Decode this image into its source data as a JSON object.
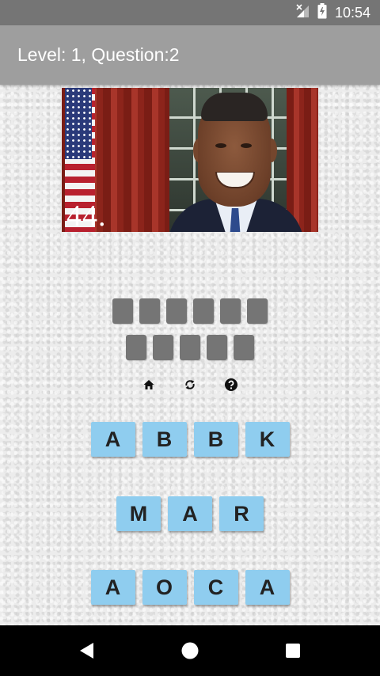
{
  "status_bar": {
    "time": "10:54",
    "icons": [
      "signal-off-icon",
      "battery-charging-icon"
    ]
  },
  "app_bar": {
    "title": "Level: 1, Question:2"
  },
  "question": {
    "image_caption": "44."
  },
  "answer": {
    "slots_row1": 6,
    "slots_row2": 5
  },
  "tools": {
    "icons": [
      "home-icon",
      "refresh-icon",
      "help-icon"
    ]
  },
  "letter_tiles": {
    "row1": [
      "A",
      "B",
      "B",
      "K"
    ],
    "row2": [
      "M",
      "A",
      "R"
    ],
    "row3": [
      "A",
      "O",
      "C",
      "A"
    ]
  },
  "nav_bar": {
    "icons": [
      "back-icon",
      "home-circle-icon",
      "recents-icon"
    ]
  },
  "colors": {
    "status_bar": "#757575",
    "app_bar": "#9e9e9e",
    "slot": "#757575",
    "tile": "#8fcdef",
    "nav_bar": "#000000"
  }
}
